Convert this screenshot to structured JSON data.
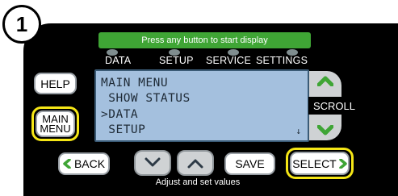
{
  "step_number": "1",
  "banner_text": "Press any button to start display",
  "categories": [
    "DATA",
    "SETUP",
    "SERVICE",
    "SETTINGS"
  ],
  "lcd": {
    "line1": "MAIN MENU",
    "line2": " SHOW STATUS",
    "line3": ">DATA",
    "line4": " SETUP",
    "scroll_indicator": "↓"
  },
  "buttons": {
    "help": "HELP",
    "main_menu_line1": "MAIN",
    "main_menu_line2": "MENU",
    "scroll": "SCROLL",
    "back": "BACK",
    "save": "SAVE",
    "select": "SELECT"
  },
  "adjust_caption": "Adjust and set values",
  "colors": {
    "panel": "#000000",
    "banner": "#3fa535",
    "lcd": "#a4c0de",
    "highlight": "#f5e616",
    "chevron": "#3fa535"
  },
  "icons": {
    "down": "chevron-down-icon",
    "up": "chevron-up-icon",
    "back": "chevron-left-icon",
    "select": "chevron-right-icon"
  }
}
